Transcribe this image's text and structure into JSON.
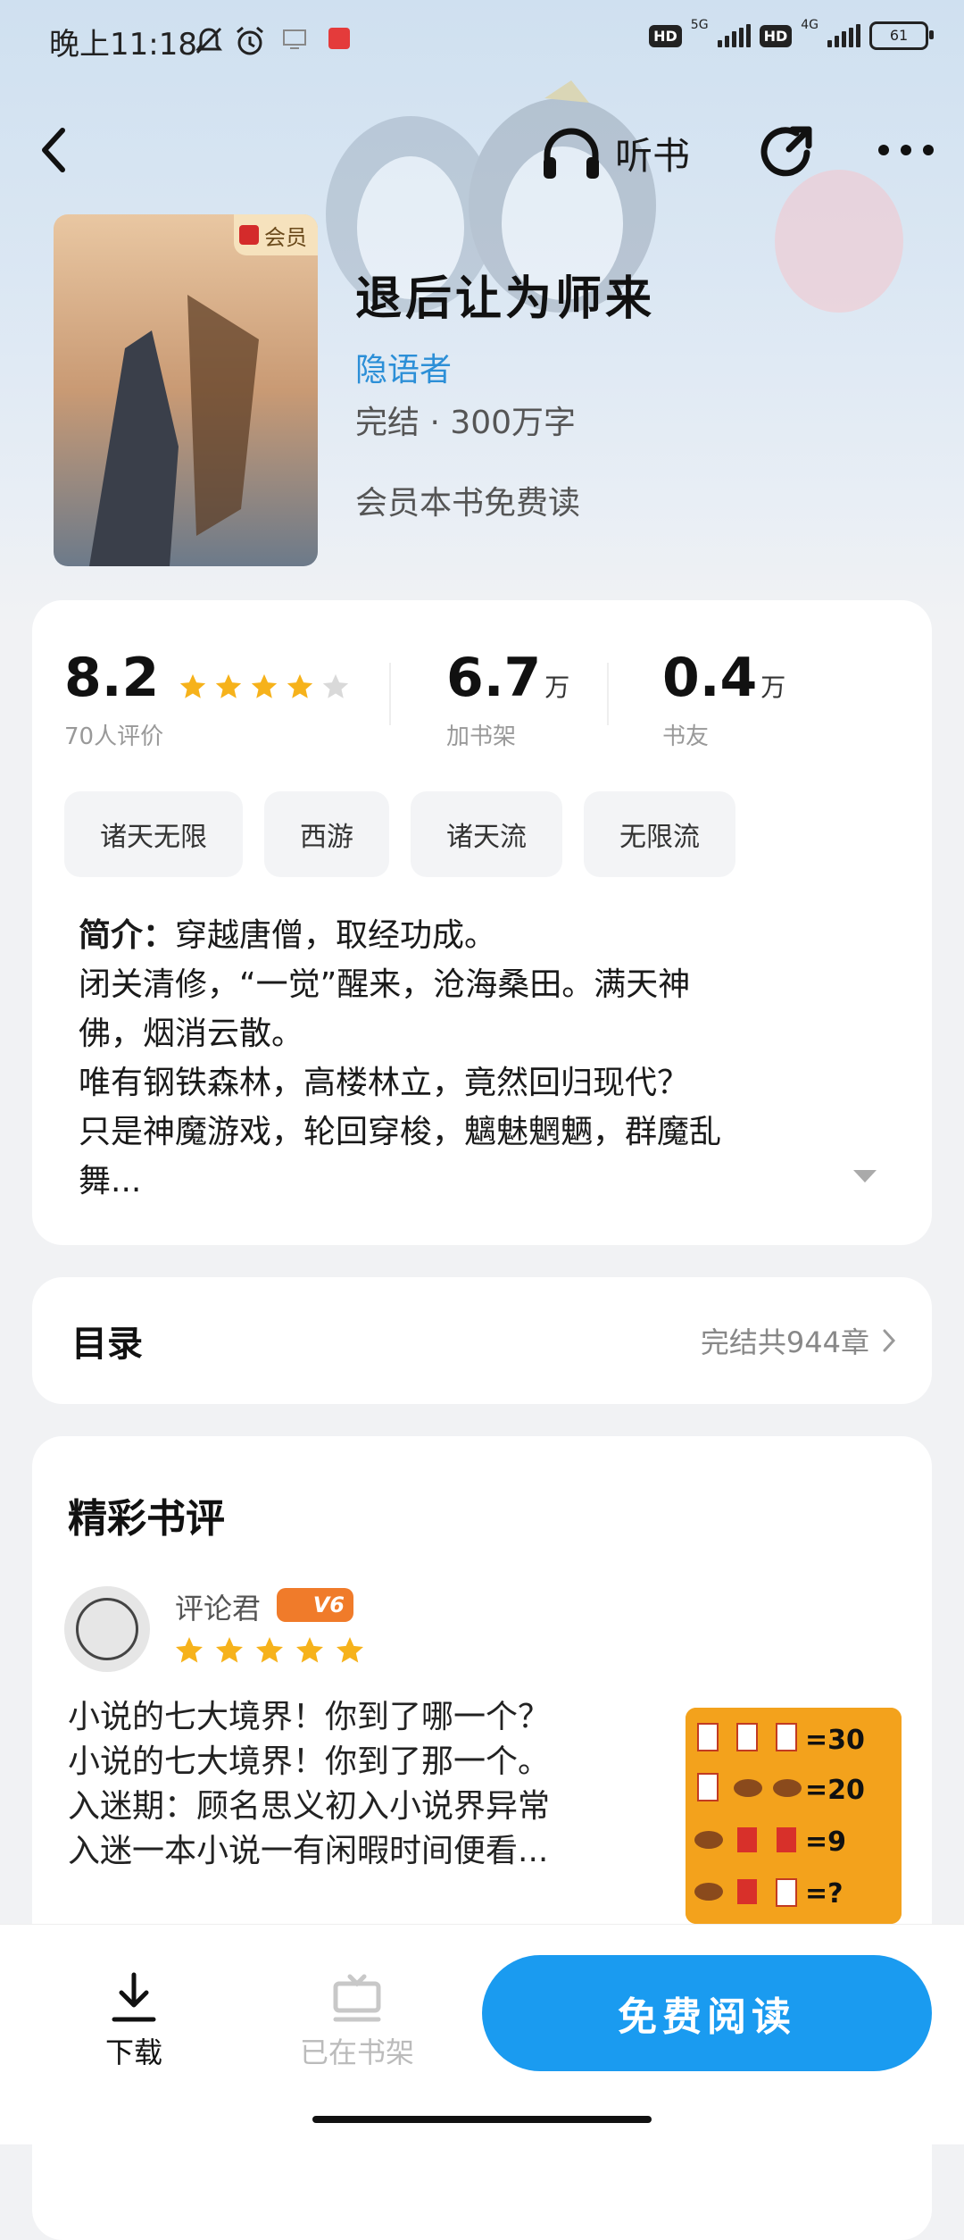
{
  "status_bar": {
    "time": "晚上11:18",
    "net1": "5G",
    "net2": "4G",
    "battery": "61",
    "hd": "HD"
  },
  "header": {
    "listen_label": "听书"
  },
  "book": {
    "title": "退后让为师来",
    "author": "隐语者",
    "status": "完结 · 300万字",
    "member_note": "会员本书免费读",
    "cover_badge": "会员"
  },
  "stats": {
    "score": "8.2",
    "score_sub": "70人评价",
    "rating_stars": 4,
    "shelf_num": "6.7",
    "shelf_unit": "万",
    "shelf_sub": "加书架",
    "friends_num": "0.4",
    "friends_unit": "万",
    "friends_sub": "书友"
  },
  "tags": [
    "诸天无限",
    "西游",
    "诸天流",
    "无限流"
  ],
  "intro": {
    "label": "简介：",
    "lines": [
      "穿越唐僧，取经功成。",
      "闭关清修，“一觉”醒来，沧海桑田。满天神",
      "佛，烟消云散。",
      "唯有钢铁森林，高楼林立，竟然回归现代？",
      "只是神魔游戏，轮回穿梭，魑魅魍魉，群魔乱",
      "舞..."
    ]
  },
  "toc": {
    "title": "目录",
    "meta": "完结共944章"
  },
  "reviews": {
    "heading": "精彩书评",
    "items": [
      {
        "name": "评论君",
        "badge": "V6",
        "stars": 5,
        "lines": [
          "小说的七大境界！你到了哪一个？",
          "小说的七大境界！你到了那一个。",
          "入迷期：顾名思义初入小说界异常",
          "入迷一本小说一有闲暇时间便看..."
        ],
        "image_values": [
          "=30",
          "=20",
          "=9",
          "=?"
        ]
      }
    ]
  },
  "bottom": {
    "download": "下载",
    "shelf": "已在书架",
    "read": "免费阅读"
  },
  "colors": {
    "accent": "#1a9bf0",
    "author": "#2c8fd7",
    "star": "#f6b21b",
    "star_empty": "#d9d9d9"
  }
}
